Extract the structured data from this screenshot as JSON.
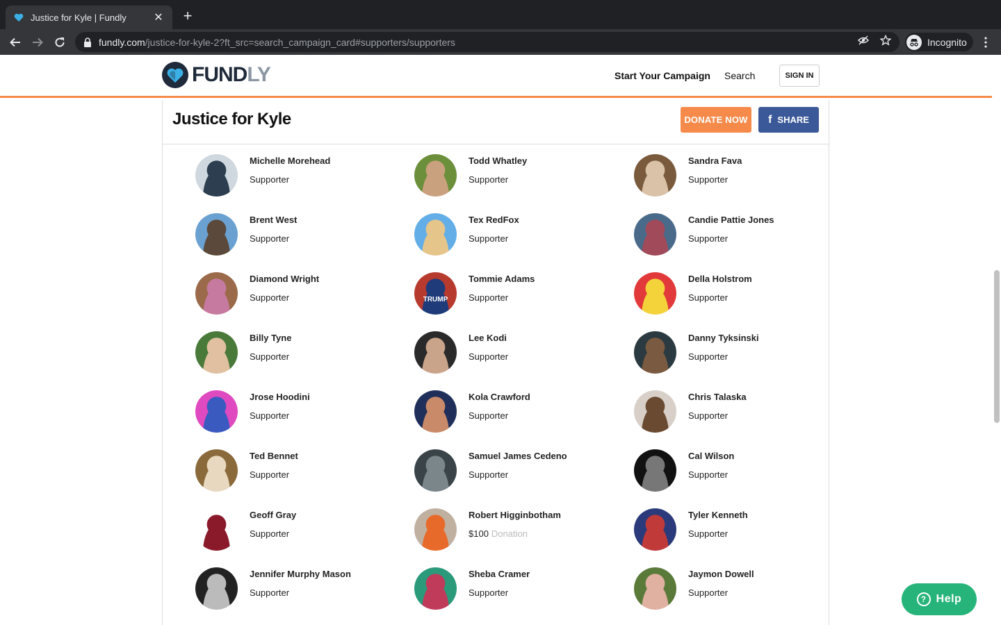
{
  "browser": {
    "tab_title": "Justice for Kyle | Fundly",
    "url_host": "fundly.com",
    "url_path": "/justice-for-kyle-2?ft_src=search_campaign_card#supporters/supporters",
    "incognito_label": "Incognito",
    "new_tab_symbol": "+",
    "close_symbol": "✕"
  },
  "header": {
    "logo_part1": "FUND",
    "logo_part2": "LY",
    "start_campaign": "Start Your Campaign",
    "search": "Search",
    "sign_in": "SIGN IN"
  },
  "campaign": {
    "title": "Justice for Kyle",
    "donate_label": "DONATE NOW",
    "share_label": "SHARE",
    "share_icon": "f"
  },
  "colors": {
    "accent_orange": "#f58a4a",
    "facebook_blue": "#3b5998",
    "help_green": "#26b47a"
  },
  "supporters": [
    {
      "name": "Michelle Morehead",
      "role": "Supporter",
      "avatar": [
        "#cfd8de",
        "#2c3e50"
      ]
    },
    {
      "name": "Todd Whatley",
      "role": "Supporter",
      "avatar": [
        "#6b8f3a",
        "#c9a17f"
      ]
    },
    {
      "name": "Sandra Fava",
      "role": "Supporter",
      "avatar": [
        "#7a5a3c",
        "#d9c2a8"
      ]
    },
    {
      "name": "Brent West",
      "role": "Supporter",
      "avatar": [
        "#6aa1d1",
        "#5b4a3b"
      ]
    },
    {
      "name": "Tex RedFox",
      "role": "Supporter",
      "avatar": [
        "#63aee6",
        "#e6c58a"
      ]
    },
    {
      "name": "Candie Pattie Jones",
      "role": "Supporter",
      "avatar": [
        "#4a6a8a",
        "#a04a5a"
      ]
    },
    {
      "name": "Diamond Wright",
      "role": "Supporter",
      "avatar": [
        "#9a6a4a",
        "#c77aa0"
      ]
    },
    {
      "name": "Tommie Adams",
      "role": "Supporter",
      "avatar": [
        "#b73a2e",
        "#1f3b7a"
      ],
      "avatar_text": "TRUMP"
    },
    {
      "name": "Della Holstrom",
      "role": "Supporter",
      "avatar": [
        "#e23a3a",
        "#f4d23a"
      ]
    },
    {
      "name": "Billy Tyne",
      "role": "Supporter",
      "avatar": [
        "#4a7a3a",
        "#e0c0a0"
      ]
    },
    {
      "name": "Lee Kodi",
      "role": "Supporter",
      "avatar": [
        "#2a2a2a",
        "#c9a48a"
      ]
    },
    {
      "name": "Danny Tyksinski",
      "role": "Supporter",
      "avatar": [
        "#2a3a40",
        "#7a5a40"
      ]
    },
    {
      "name": "Jrose Hoodini",
      "role": "Supporter",
      "avatar": [
        "#e04ac0",
        "#3a5ac0"
      ]
    },
    {
      "name": "Kola Crawford",
      "role": "Supporter",
      "avatar": [
        "#1f2f5a",
        "#c98a6a"
      ]
    },
    {
      "name": "Chris Talaska",
      "role": "Supporter",
      "avatar": [
        "#d8d0c8",
        "#6a4a30"
      ]
    },
    {
      "name": "Ted Bennet",
      "role": "Supporter",
      "avatar": [
        "#8a6a3a",
        "#e8d8c0"
      ]
    },
    {
      "name": "Samuel James Cedeno",
      "role": "Supporter",
      "avatar": [
        "#3a4448",
        "#7a868a"
      ]
    },
    {
      "name": "Cal Wilson",
      "role": "Supporter",
      "avatar": [
        "#111111",
        "#777777"
      ]
    },
    {
      "name": "Geoff Gray",
      "role": "Supporter",
      "avatar": [
        "#ffffff",
        "#8a1a2a"
      ]
    },
    {
      "name": "Robert Higginbotham",
      "role": "$100",
      "donation": "Donation",
      "avatar": [
        "#c0b0a0",
        "#e86a2a"
      ]
    },
    {
      "name": "Tyler Kenneth",
      "role": "Supporter",
      "avatar": [
        "#2a3a7a",
        "#c03a3a"
      ]
    },
    {
      "name": "Jennifer Murphy Mason",
      "role": "Supporter",
      "avatar": [
        "#222222",
        "#bbbbbb"
      ]
    },
    {
      "name": "Sheba Cramer",
      "role": "Supporter",
      "avatar": [
        "#2a9a7a",
        "#c03a5a"
      ]
    },
    {
      "name": "Jaymon Dowell",
      "role": "Supporter",
      "avatar": [
        "#5a7a3a",
        "#e0b0a0"
      ]
    }
  ],
  "help": {
    "label": "Help",
    "icon_glyph": "?"
  }
}
